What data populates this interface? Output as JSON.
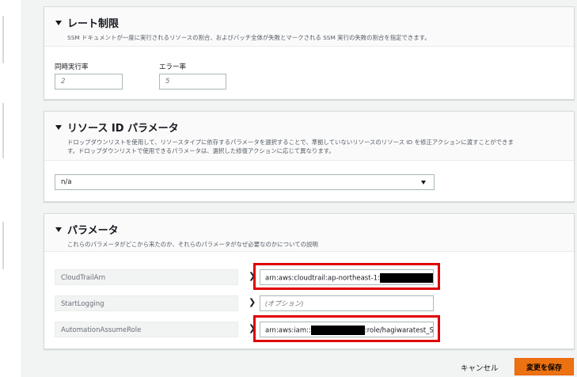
{
  "rate_limit": {
    "title": "レート制限",
    "description": "SSM ドキュメントが一度に実行されるリソースの割合、およびバッチ全体が失敗とマークされる SSM 実行の失敗の割合を指定できます。",
    "concurrency_label": "同時実行率",
    "concurrency_placeholder": "2",
    "error_label": "エラー率",
    "error_placeholder": "5"
  },
  "resource_id": {
    "title": "リソース ID パラメータ",
    "description_line1": "ドロップダウンリストを使用して、リソースタイプに依存するパラメータを選択することで、準拠していないリソースのリソース ID を修正アクションに渡すことができま",
    "description_line2": "す。ドロップダウンリストで使用できるパラメータは、選択した修復アクションに応じて異なります。",
    "selected_value": "n/a"
  },
  "parameters": {
    "title": "パラメータ",
    "description": "これらのパラメータがどこから来たのか、それらのパラメータがなぜ必要なのかについての説明",
    "rows": [
      {
        "key": "CloudTrailArn",
        "value_prefix": "arn:aws:cloudtrail:ap-northeast-1:",
        "value_suffix": ""
      },
      {
        "key": "StartLogging",
        "placeholder": "(オプション)"
      },
      {
        "key": "AutomationAssumeRole",
        "value_prefix": "arn:aws:iam::",
        "value_suffix": ":role/hagiwaratest_S"
      }
    ]
  },
  "footer": {
    "cancel_label": "キャンセル",
    "save_label": "変更を保存"
  },
  "colors": {
    "accent": "#ec7211",
    "highlight": "#e00000"
  }
}
